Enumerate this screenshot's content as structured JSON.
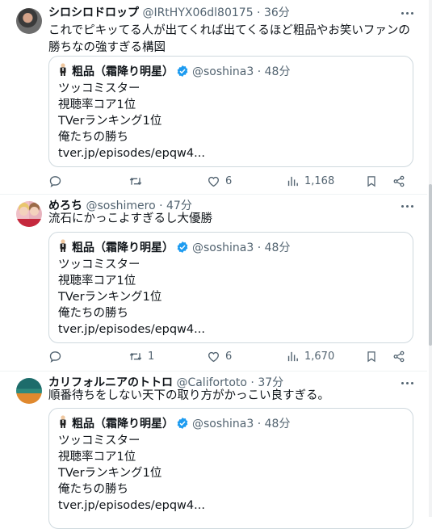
{
  "tweets": [
    {
      "name": "シロシロドロップ",
      "handle": "@IRtHYX06dl80175",
      "time": "36分",
      "text": "これでピキッてる人が出てくれば出てくるほど粗品やお笑いファンの勝ちなの強すぎる構図",
      "quote": {
        "name": "粗品（霜降り明星）",
        "handle": "@soshina3",
        "time": "48分",
        "lines": [
          "ツッコミスター",
          "視聴率コア1位",
          "TVerランキング1位",
          "俺たちの勝ち",
          "tver.jp/episodes/epqw4..."
        ]
      },
      "actions": {
        "reply": "",
        "retweet": "",
        "like": "6",
        "views": "1,168"
      }
    },
    {
      "name": "めろち",
      "handle": "@soshimero",
      "time": "47分",
      "text": "流石にかっこよすぎるし大優勝",
      "quote": {
        "name": "粗品（霜降り明星）",
        "handle": "@soshina3",
        "time": "48分",
        "lines": [
          "ツッコミスター",
          "視聴率コア1位",
          "TVerランキング1位",
          "俺たちの勝ち",
          "tver.jp/episodes/epqw4..."
        ]
      },
      "actions": {
        "reply": "",
        "retweet": "1",
        "like": "6",
        "views": "1,670"
      }
    },
    {
      "name": "カリフォルニアのトトロ",
      "handle": "@Califortoto",
      "time": "37分",
      "text": "順番待ちをしない天下の取り方がかっこい良すぎる。",
      "quote": {
        "name": "粗品（霜降り明星）",
        "handle": "@soshina3",
        "time": "48分",
        "lines": [
          "ツッコミスター",
          "視聴率コア1位",
          "TVerランキング1位",
          "俺たちの勝ち",
          "tver.jp/episodes/epqw4..."
        ]
      }
    }
  ],
  "colors": {
    "text": "#0f1419",
    "secondary": "#536471",
    "verified": "#1d9bf0",
    "border": "#cfd9de"
  },
  "icons": [
    "more-icon",
    "verified-icon",
    "reply-icon",
    "retweet-icon",
    "like-icon",
    "views-icon",
    "bookmark-icon",
    "share-icon"
  ]
}
